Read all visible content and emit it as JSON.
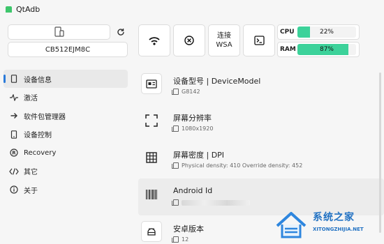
{
  "window": {
    "title": "QtAdb"
  },
  "device": {
    "serial": "CB512EJM8C"
  },
  "toolbar": {
    "wsa_line1": "连接",
    "wsa_line2": "WSA"
  },
  "meters": {
    "cpu": {
      "label": "CPU",
      "value": "22%",
      "fraction": 0.22,
      "color": "#3cd29a"
    },
    "ram": {
      "label": "RAM",
      "value": "87%",
      "fraction": 0.87,
      "color": "#3cd29a"
    }
  },
  "sidebar": {
    "items": [
      {
        "label": "设备信息",
        "icon": "phone-icon",
        "active": true
      },
      {
        "label": "激活",
        "icon": "pulse-icon"
      },
      {
        "label": "软件包管理器",
        "icon": "arrow-right-icon"
      },
      {
        "label": "设备控制",
        "icon": "phone-control-icon"
      },
      {
        "label": "Recovery",
        "icon": "registered-icon"
      },
      {
        "label": "其它",
        "icon": "code-icon"
      },
      {
        "label": "关于",
        "icon": "info-icon"
      }
    ]
  },
  "info": {
    "items": [
      {
        "title": "设备型号 | DeviceModel",
        "value": "G8142",
        "icon": "id-card-icon"
      },
      {
        "title": "屏幕分辨率",
        "value": "1080x1920",
        "icon": "fullscreen-icon"
      },
      {
        "title": "屏幕密度 | DPI",
        "value": "Physical density: 410 Override density: 452",
        "icon": "grid-icon"
      },
      {
        "title": "Android Id",
        "value": "",
        "icon": "barcode-icon"
      },
      {
        "title": "安卓版本",
        "value": "12",
        "icon": "android-icon"
      }
    ]
  },
  "watermark": {
    "text": "系统之家",
    "url": "XITONGZHIJIA.NET"
  },
  "colors": {
    "accent": "#2a7ad9",
    "meter": "#3cd29a"
  }
}
